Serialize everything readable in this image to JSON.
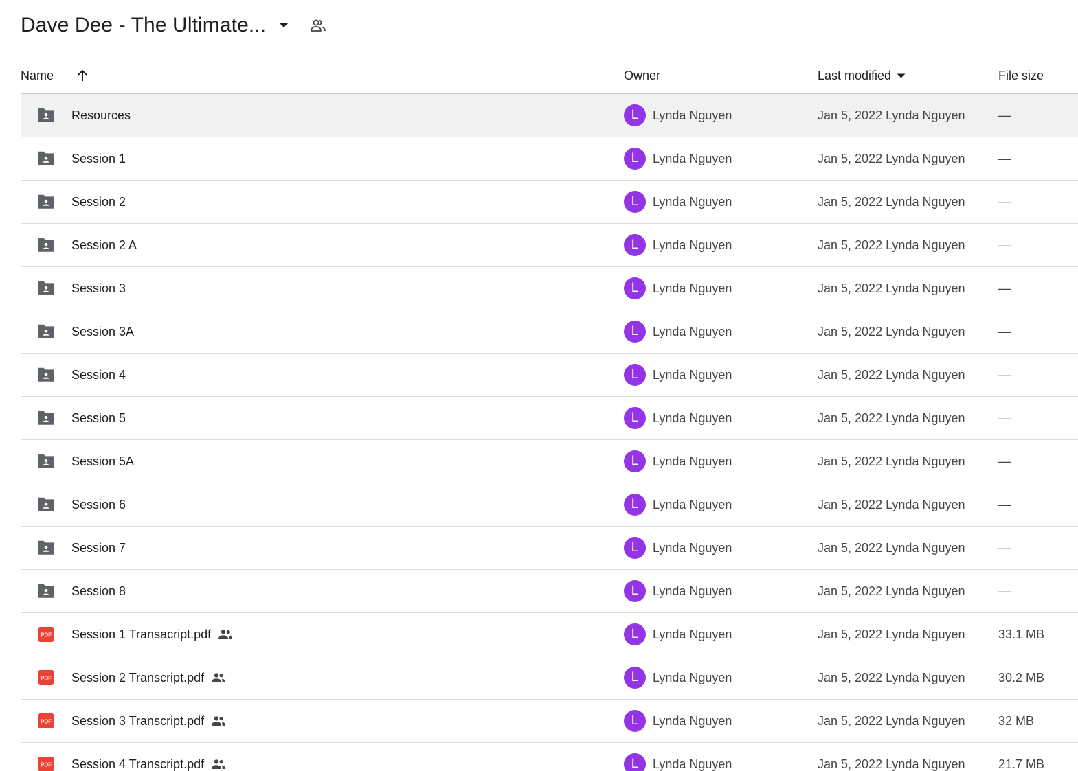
{
  "header": {
    "title": "Dave Dee - The Ultimate...",
    "caret_icon": "arrow-drop-down-icon",
    "share_icon": "people-outline-icon"
  },
  "columns": {
    "name": "Name",
    "owner": "Owner",
    "last_modified": "Last modified",
    "file_size": "File size",
    "sort_icon": "arrow-up-icon"
  },
  "colors": {
    "avatar_bg": "#9334e6",
    "folder_icon": "#5f6368",
    "pdf_icon": "#ea4335",
    "selected_row_bg": "#f0f1f1"
  },
  "rows": [
    {
      "name": "Resources",
      "type": "folder",
      "shared": false,
      "owner_initial": "L",
      "owner": "Lynda Nguyen",
      "modified": "Jan 5, 2022 Lynda Nguyen",
      "size": "—",
      "selected": true
    },
    {
      "name": "Session 1",
      "type": "folder",
      "shared": false,
      "owner_initial": "L",
      "owner": "Lynda Nguyen",
      "modified": "Jan 5, 2022 Lynda Nguyen",
      "size": "—",
      "selected": false
    },
    {
      "name": "Session 2",
      "type": "folder",
      "shared": false,
      "owner_initial": "L",
      "owner": "Lynda Nguyen",
      "modified": "Jan 5, 2022 Lynda Nguyen",
      "size": "—",
      "selected": false
    },
    {
      "name": "Session 2 A",
      "type": "folder",
      "shared": false,
      "owner_initial": "L",
      "owner": "Lynda Nguyen",
      "modified": "Jan 5, 2022 Lynda Nguyen",
      "size": "—",
      "selected": false
    },
    {
      "name": "Session 3",
      "type": "folder",
      "shared": false,
      "owner_initial": "L",
      "owner": "Lynda Nguyen",
      "modified": "Jan 5, 2022 Lynda Nguyen",
      "size": "—",
      "selected": false
    },
    {
      "name": "Session 3A",
      "type": "folder",
      "shared": false,
      "owner_initial": "L",
      "owner": "Lynda Nguyen",
      "modified": "Jan 5, 2022 Lynda Nguyen",
      "size": "—",
      "selected": false
    },
    {
      "name": "Session 4",
      "type": "folder",
      "shared": false,
      "owner_initial": "L",
      "owner": "Lynda Nguyen",
      "modified": "Jan 5, 2022 Lynda Nguyen",
      "size": "—",
      "selected": false
    },
    {
      "name": "Session 5",
      "type": "folder",
      "shared": false,
      "owner_initial": "L",
      "owner": "Lynda Nguyen",
      "modified": "Jan 5, 2022 Lynda Nguyen",
      "size": "—",
      "selected": false
    },
    {
      "name": "Session 5A",
      "type": "folder",
      "shared": false,
      "owner_initial": "L",
      "owner": "Lynda Nguyen",
      "modified": "Jan 5, 2022 Lynda Nguyen",
      "size": "—",
      "selected": false
    },
    {
      "name": "Session 6",
      "type": "folder",
      "shared": false,
      "owner_initial": "L",
      "owner": "Lynda Nguyen",
      "modified": "Jan 5, 2022 Lynda Nguyen",
      "size": "—",
      "selected": false
    },
    {
      "name": "Session 7",
      "type": "folder",
      "shared": false,
      "owner_initial": "L",
      "owner": "Lynda Nguyen",
      "modified": "Jan 5, 2022 Lynda Nguyen",
      "size": "—",
      "selected": false
    },
    {
      "name": "Session 8",
      "type": "folder",
      "shared": false,
      "owner_initial": "L",
      "owner": "Lynda Nguyen",
      "modified": "Jan 5, 2022 Lynda Nguyen",
      "size": "—",
      "selected": false
    },
    {
      "name": "Session 1 Transacript.pdf",
      "type": "pdf",
      "shared": true,
      "owner_initial": "L",
      "owner": "Lynda Nguyen",
      "modified": "Jan 5, 2022 Lynda Nguyen",
      "size": "33.1 MB",
      "selected": false
    },
    {
      "name": "Session 2 Transcript.pdf",
      "type": "pdf",
      "shared": true,
      "owner_initial": "L",
      "owner": "Lynda Nguyen",
      "modified": "Jan 5, 2022 Lynda Nguyen",
      "size": "30.2 MB",
      "selected": false
    },
    {
      "name": "Session 3 Transcript.pdf",
      "type": "pdf",
      "shared": true,
      "owner_initial": "L",
      "owner": "Lynda Nguyen",
      "modified": "Jan 5, 2022 Lynda Nguyen",
      "size": "32 MB",
      "selected": false
    },
    {
      "name": "Session 4 Transcript.pdf",
      "type": "pdf",
      "shared": true,
      "owner_initial": "L",
      "owner": "Lynda Nguyen",
      "modified": "Jan 5, 2022 Lynda Nguyen",
      "size": "21.7 MB",
      "selected": false
    }
  ]
}
